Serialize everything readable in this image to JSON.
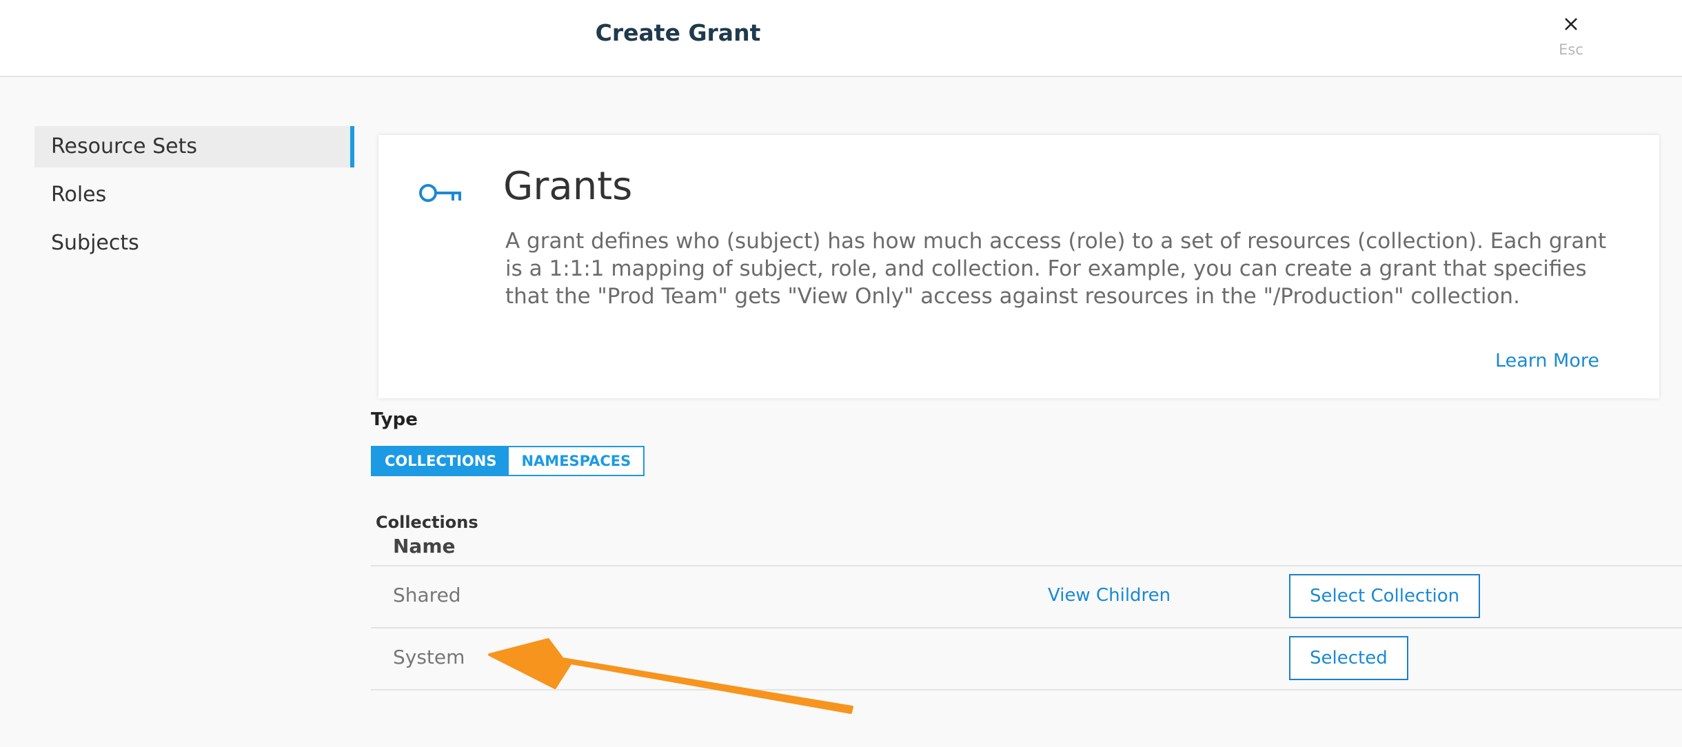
{
  "header": {
    "title": "Create Grant",
    "close_hint": "Esc"
  },
  "sidebar": {
    "items": [
      {
        "label": "Resource Sets",
        "active": true
      },
      {
        "label": "Roles",
        "active": false
      },
      {
        "label": "Subjects",
        "active": false
      }
    ]
  },
  "info_card": {
    "icon": "key-icon",
    "title": "Grants",
    "description": "A grant defines who (subject) has how much access (role) to a set of resources (collection). Each grant is a 1:1:1 mapping of subject, role, and collection. For example, you can create a grant that specifies that the \"Prod Team\" gets \"View Only\" access against resources in the \"/Production\" collection.",
    "learn_more": "Learn More"
  },
  "type": {
    "label": "Type",
    "options": [
      {
        "label": "COLLECTIONS",
        "active": true
      },
      {
        "label": "NAMESPACES",
        "active": false
      }
    ]
  },
  "collections": {
    "label": "Collections",
    "name_header": "Name",
    "rows": [
      {
        "name": "Shared",
        "view_children": "View Children",
        "action": "Select Collection"
      },
      {
        "name": "System",
        "view_children": "",
        "action": "Selected"
      }
    ]
  },
  "colors": {
    "accent": "#1c9ae3",
    "annotation_arrow": "#f7941d",
    "title": "#1f3a4d"
  }
}
